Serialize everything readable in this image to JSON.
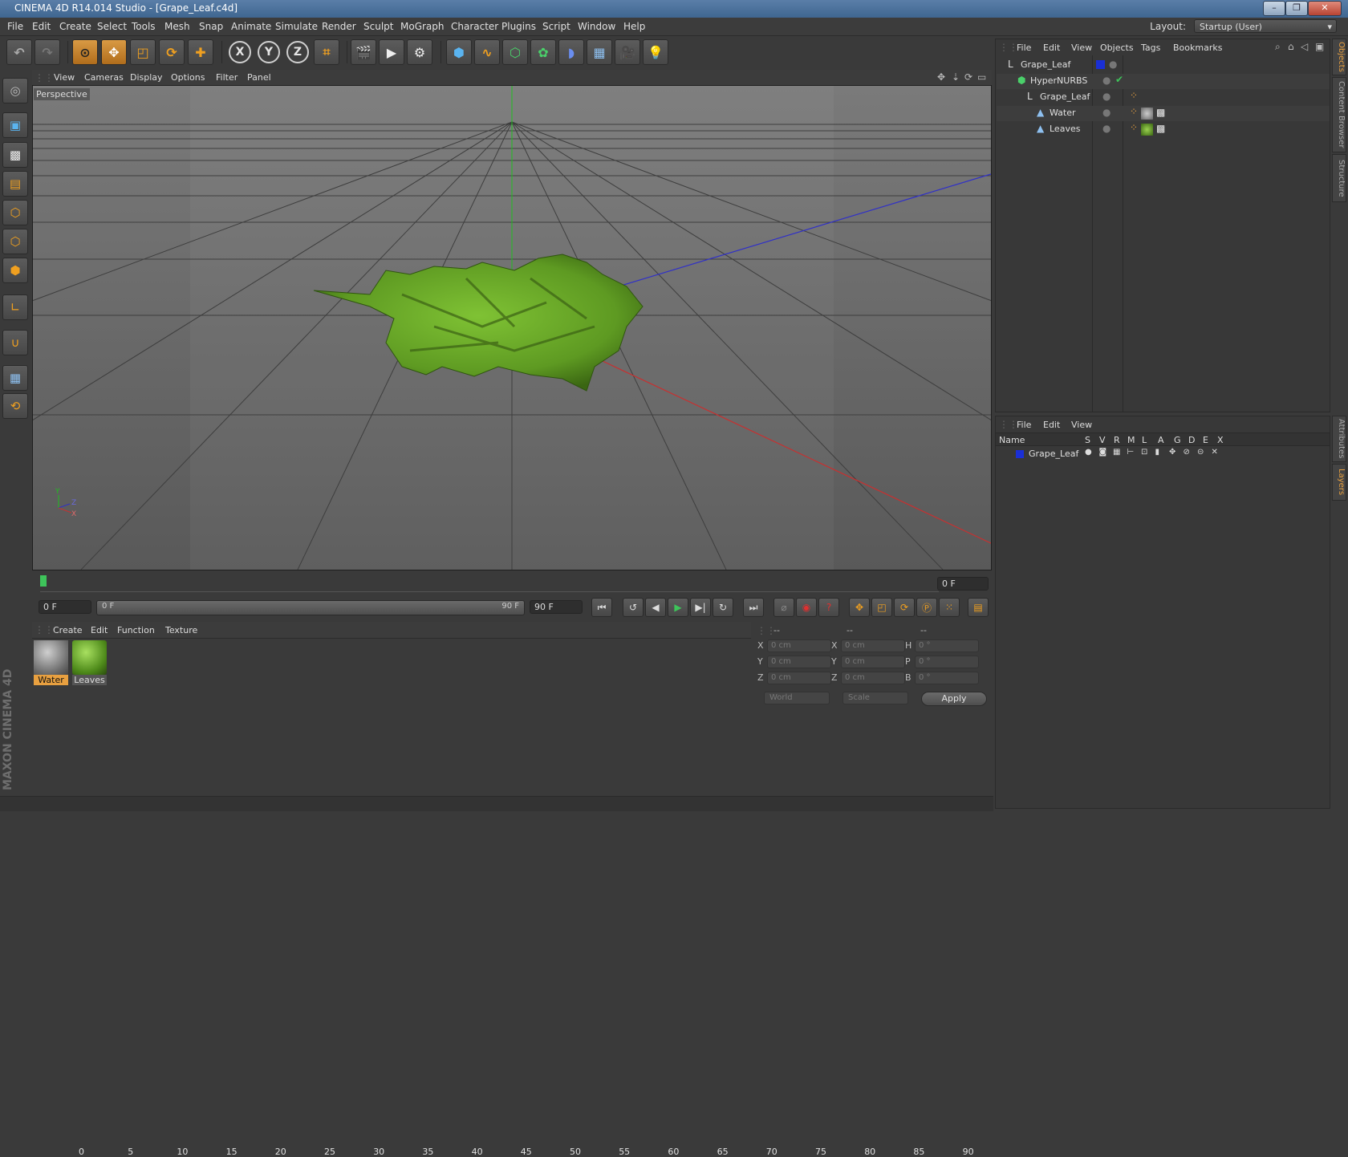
{
  "window": {
    "title": "CINEMA 4D R14.014 Studio - [Grape_Leaf.c4d]",
    "controls": [
      "–",
      "❐",
      "✕"
    ]
  },
  "menubar": {
    "items": [
      "File",
      "Edit",
      "Create",
      "Select",
      "Tools",
      "Mesh",
      "Snap",
      "Animate",
      "Simulate",
      "Render",
      "Sculpt",
      "MoGraph",
      "Character",
      "Plugins",
      "Script",
      "Window",
      "Help"
    ],
    "layout_label": "Layout:",
    "layout_value": "Startup (User)"
  },
  "viewport": {
    "menu": [
      "View",
      "Cameras",
      "Display",
      "Options",
      "Filter",
      "Panel"
    ],
    "label": "Perspective",
    "axis_labels": {
      "y": "Y",
      "z": "Z",
      "x": "X"
    }
  },
  "timeline": {
    "ticks": [
      "0",
      "5",
      "10",
      "15",
      "20",
      "25",
      "30",
      "35",
      "40",
      "45",
      "50",
      "55",
      "60",
      "65",
      "70",
      "75",
      "80",
      "85",
      "90"
    ],
    "current_frame": "0 F",
    "start_field": "0 F",
    "range_start": "0 F",
    "range_end": "90 F",
    "end_field": "90 F"
  },
  "material_manager": {
    "menu": [
      "Create",
      "Edit",
      "Function",
      "Texture"
    ],
    "materials": [
      {
        "name": "Water",
        "selected": true
      },
      {
        "name": "Leaves",
        "selected": false
      }
    ]
  },
  "coordinates": {
    "headers": [
      "--",
      "--",
      "--"
    ],
    "rows": [
      {
        "a": "X",
        "av": "0 cm",
        "b": "X",
        "bv": "0 cm",
        "c": "H",
        "cv": "0 °"
      },
      {
        "a": "Y",
        "av": "0 cm",
        "b": "Y",
        "bv": "0 cm",
        "c": "P",
        "cv": "0 °"
      },
      {
        "a": "Z",
        "av": "0 cm",
        "b": "Z",
        "bv": "0 cm",
        "c": "B",
        "cv": "0 °"
      }
    ],
    "mode": "World",
    "size_mode": "Scale",
    "apply": "Apply"
  },
  "object_manager": {
    "menu": [
      "File",
      "Edit",
      "View",
      "Objects",
      "Tags",
      "Bookmarks"
    ],
    "objects": [
      {
        "name": "Grape_Leaf",
        "indent": 0
      },
      {
        "name": "HyperNURBS",
        "indent": 1
      },
      {
        "name": "Grape_Leaf",
        "indent": 2
      },
      {
        "name": "Water",
        "indent": 3
      },
      {
        "name": "Leaves",
        "indent": 3
      }
    ]
  },
  "layer_manager": {
    "menu": [
      "File",
      "Edit",
      "View"
    ],
    "columns": [
      "Name",
      "S",
      "V",
      "R",
      "M",
      "L",
      "A",
      "G",
      "D",
      "E",
      "X"
    ],
    "layers": [
      {
        "name": "Grape_Leaf",
        "color": "#1a2fd6"
      }
    ]
  },
  "side_tabs": [
    "Objects",
    "Content Browser",
    "Structure",
    "Attributes",
    "Layers"
  ],
  "brand": "MAXON CINEMA 4D",
  "colors": {
    "accent": "#e8a040",
    "layer_blue": "#1a2fd6",
    "leaf_green": "#6aa82a"
  }
}
